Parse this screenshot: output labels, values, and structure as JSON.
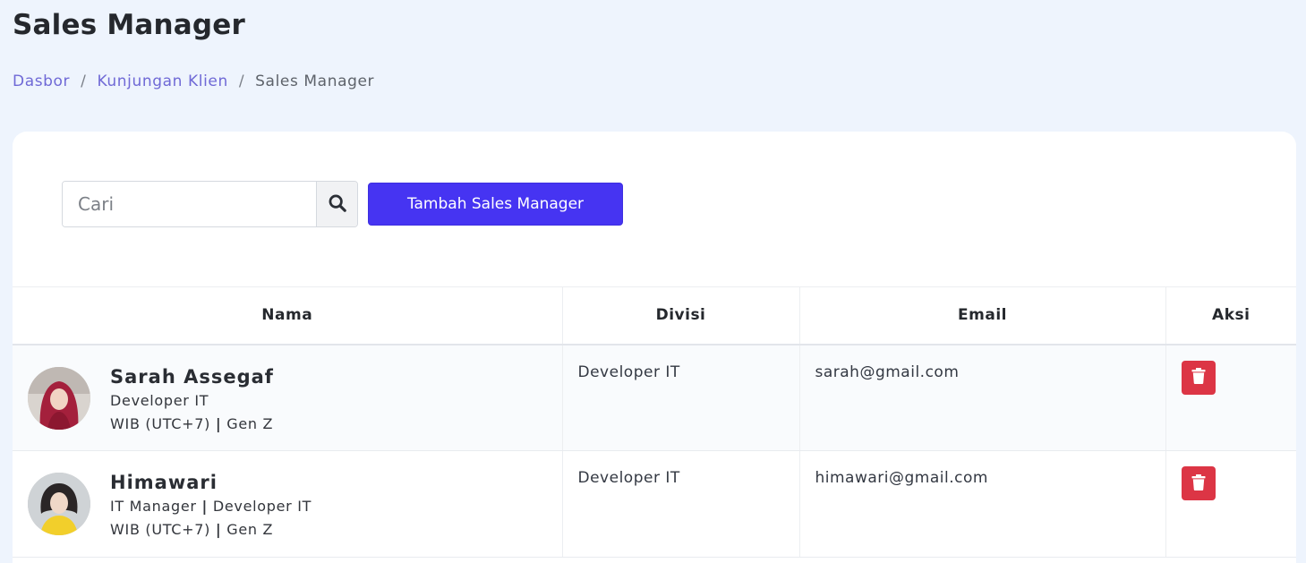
{
  "page": {
    "title": "Sales Manager"
  },
  "breadcrumb": {
    "items": [
      {
        "label": "Dasbor",
        "link": true
      },
      {
        "label": "Kunjungan Klien",
        "link": true
      },
      {
        "label": "Sales Manager",
        "link": false
      }
    ],
    "separator": "/"
  },
  "toolbar": {
    "search_placeholder": "Cari",
    "search_value": "",
    "search_icon": "search-icon",
    "add_label": "Tambah Sales Manager"
  },
  "table": {
    "headers": {
      "name": "Nama",
      "division": "Divisi",
      "email": "Email",
      "action": "Aksi"
    },
    "rows": [
      {
        "name": "Sarah Assegaf",
        "role": "Developer IT",
        "timezone": "WIB (UTC+7)",
        "generation": "Gen Z",
        "division": "Developer IT",
        "email": "sarah@gmail.com"
      },
      {
        "name": "Himawari",
        "role_primary": "IT Manager",
        "role_secondary": "Developer IT",
        "timezone": "WIB (UTC+7)",
        "generation": "Gen Z",
        "division": "Developer IT",
        "email": "himawari@gmail.com"
      }
    ]
  },
  "colors": {
    "primary_button": "#4634f2",
    "delete_button": "#dc3545",
    "link": "#6f69d6",
    "background": "#eef4fd"
  }
}
